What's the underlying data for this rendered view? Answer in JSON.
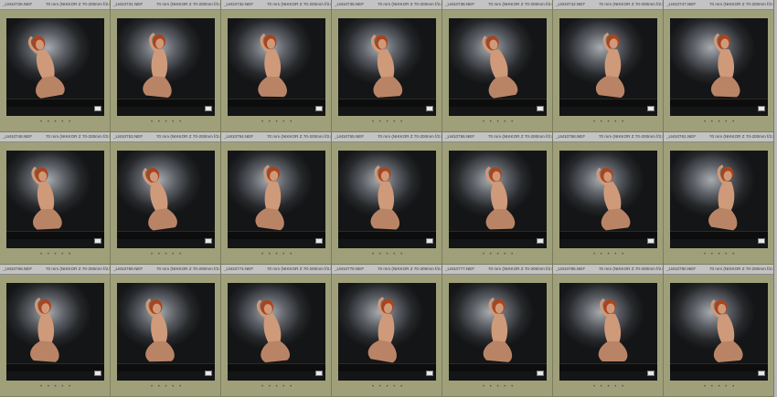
{
  "grid": {
    "lens_label": "70 mm (NIKKOR Z 70-200mm f/2.8 VR S)",
    "rating_dots": "• • • • •",
    "items": [
      {
        "filename": "_LM10726.NEF"
      },
      {
        "filename": "_LM10731.NEF"
      },
      {
        "filename": "_LM10732.NEF"
      },
      {
        "filename": "_LM10736.NEF"
      },
      {
        "filename": "_LM10738.NEF"
      },
      {
        "filename": "_LM10742.NEF"
      },
      {
        "filename": "_LM10747.NEF"
      },
      {
        "filename": "_LM10748.NEF"
      },
      {
        "filename": "_LM10753.NEF"
      },
      {
        "filename": "_LM10754.NEF"
      },
      {
        "filename": "_LM10755.NEF"
      },
      {
        "filename": "_LM10756.NEF"
      },
      {
        "filename": "_LM10758.NEF"
      },
      {
        "filename": "_LM10761.NEF"
      },
      {
        "filename": "_LM10766.NEF"
      },
      {
        "filename": "_LM10769.NEF"
      },
      {
        "filename": "_LM10774.NEF"
      },
      {
        "filename": "_LM10776.NEF"
      },
      {
        "filename": "_LM10777.NEF"
      },
      {
        "filename": "_LM10785.NEF"
      },
      {
        "filename": "_LM10790.NEF"
      }
    ]
  },
  "colors": {
    "cell_bg": "#9fa07a",
    "header_bg": "#c3c3c3",
    "figure": "#cf9a7a",
    "hair": "#a8451f"
  }
}
